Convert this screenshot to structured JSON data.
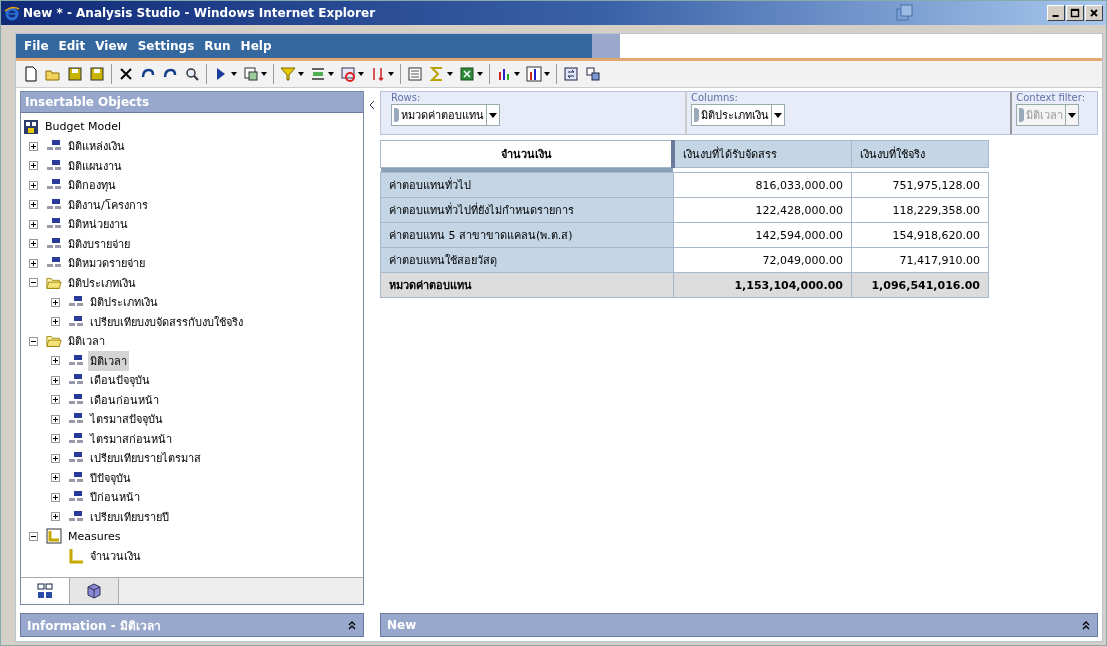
{
  "window": {
    "title": "New * - Analysis Studio - Windows Internet Explorer"
  },
  "menu": [
    "File",
    "Edit",
    "View",
    "Settings",
    "Run",
    "Help"
  ],
  "insertable_objects": {
    "title": "Insertable Objects",
    "tree": [
      {
        "label": "Budget Model",
        "kind": "model",
        "selected": false,
        "children": [
          {
            "label": "มิติแหล่งเงิน",
            "kind": "dimension",
            "expanded": false,
            "selected": false
          },
          {
            "label": "มิติแผนงาน",
            "kind": "dimension",
            "expanded": false,
            "selected": false
          },
          {
            "label": "มิติกองทุน",
            "kind": "dimension",
            "expanded": false,
            "selected": false
          },
          {
            "label": "มิติงาน/โครงการ",
            "kind": "dimension",
            "expanded": false,
            "selected": false
          },
          {
            "label": "มิติหน่วยงาน",
            "kind": "dimension",
            "expanded": false,
            "selected": false
          },
          {
            "label": "มิติงบรายจ่าย",
            "kind": "dimension",
            "expanded": false,
            "selected": false
          },
          {
            "label": "มิติหมวดรายจ่าย",
            "kind": "dimension",
            "expanded": false,
            "selected": false
          },
          {
            "label": "มิติประเภทเงิน",
            "kind": "folder",
            "expanded": true,
            "selected": false,
            "children": [
              {
                "label": "มิติประเภทเงิน",
                "kind": "dimension",
                "expanded": false,
                "selected": false
              },
              {
                "label": "เปรียบเทียบงบจัดสรรกับงบใช้จริง",
                "kind": "dimension",
                "expanded": false,
                "selected": false
              }
            ]
          },
          {
            "label": "มิติเวลา",
            "kind": "folder",
            "expanded": true,
            "selected": false,
            "children": [
              {
                "label": "มิติเวลา",
                "kind": "dimension",
                "expanded": false,
                "selected": true
              },
              {
                "label": "เดือนปัจจุบัน",
                "kind": "dimension",
                "expanded": false,
                "selected": false
              },
              {
                "label": "เดือนก่อนหน้า",
                "kind": "dimension",
                "expanded": false,
                "selected": false
              },
              {
                "label": "ไตรมาสปัจจุบัน",
                "kind": "dimension",
                "expanded": false,
                "selected": false
              },
              {
                "label": "ไตรมาสก่อนหน้า",
                "kind": "dimension",
                "expanded": false,
                "selected": false
              },
              {
                "label": "เปรียบเทียบรายไตรมาส",
                "kind": "dimension",
                "expanded": false,
                "selected": false
              },
              {
                "label": "ปีปัจจุบัน",
                "kind": "dimension",
                "expanded": false,
                "selected": false
              },
              {
                "label": "ปีก่อนหน้า",
                "kind": "dimension",
                "expanded": false,
                "selected": false
              },
              {
                "label": "เปรียบเทียบรายปี",
                "kind": "dimension",
                "expanded": false,
                "selected": false
              }
            ]
          },
          {
            "label": "Measures",
            "kind": "measures",
            "expanded": true,
            "selected": false,
            "children": [
              {
                "label": "จำนวนเงิน",
                "kind": "measure",
                "selected": false
              }
            ]
          }
        ]
      }
    ],
    "tabs": [
      {
        "kind": "tree",
        "selected": true
      },
      {
        "kind": "cube",
        "selected": false
      }
    ]
  },
  "overview": {
    "rows": {
      "label": "Rows:",
      "value": "หมวดค่าตอบแทน",
      "disabled": false
    },
    "columns": {
      "label": "Columns:",
      "value": "มิติประเภทเงิน",
      "disabled": false
    },
    "context_filter": {
      "label": "Context filter:",
      "value": "มิติเวลา",
      "disabled": true
    }
  },
  "table": {
    "corner": "จำนวนเงิน",
    "columns": [
      "เงินงบที่ได้รับจัดสรร",
      "เงินงบที่ใช้จริง"
    ],
    "rows": [
      {
        "label": "ค่าตอบแทนทั่วไป",
        "kind": "data",
        "values": [
          "816,033,000.00",
          "751,975,128.00"
        ]
      },
      {
        "label": "ค่าตอบแทนทั่วไปที่ยังไม่กำหนดรายการ",
        "kind": "data",
        "values": [
          "122,428,000.00",
          "118,229,358.00"
        ]
      },
      {
        "label": "ค่าตอบแทน 5 สาขาขาดแคลน(พ.ต.ส)",
        "kind": "data",
        "values": [
          "142,594,000.00",
          "154,918,620.00"
        ]
      },
      {
        "label": "ค่าตอบแทนใช้สอยวัสดุ",
        "kind": "data",
        "values": [
          "72,049,000.00",
          "71,417,910.00"
        ]
      },
      {
        "label": "หมวดค่าตอบแทน",
        "kind": "total",
        "values": [
          "1,153,104,000.00",
          "1,096,541,016.00"
        ]
      }
    ]
  },
  "information_panel": {
    "title": "Information - มิติเวลา"
  },
  "new_panel": {
    "title": "New"
  }
}
